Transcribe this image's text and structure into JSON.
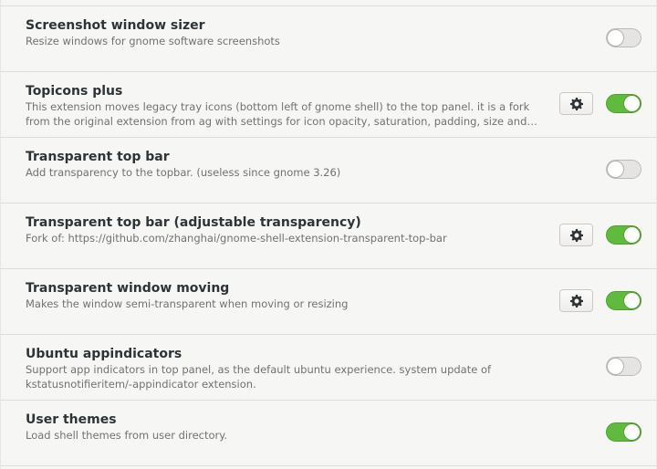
{
  "extensions": [
    {
      "title": "Screenshot window sizer",
      "description": "Resize windows for gnome software screenshots",
      "has_settings": false,
      "enabled": false
    },
    {
      "title": "Topicons plus",
      "description": "This extension moves legacy tray icons (bottom left of gnome shell) to the top panel. it is a fork from the original extension from ag  with settings for icon opacity, saturation, padding, size and tray posi…",
      "has_settings": true,
      "enabled": true
    },
    {
      "title": "Transparent top bar",
      "description": "Add transparency to the topbar. (useless since gnome 3.26)",
      "has_settings": false,
      "enabled": false
    },
    {
      "title": "Transparent top bar (adjustable transparency)",
      "description": "Fork of: https://github.com/zhanghai/gnome-shell-extension-transparent-top-bar",
      "has_settings": true,
      "enabled": true
    },
    {
      "title": "Transparent window moving",
      "description": "Makes the window semi-transparent when moving or resizing",
      "has_settings": true,
      "enabled": true
    },
    {
      "title": "Ubuntu appindicators",
      "description": "Support app indicators in top panel, as the default ubuntu experience. system update of kstatusnotifieritem/-appindicator extension.",
      "has_settings": false,
      "enabled": false
    },
    {
      "title": "User themes",
      "description": "Load shell themes from user directory.",
      "has_settings": false,
      "enabled": true
    }
  ],
  "icons": {
    "settings": "gear-icon"
  },
  "colors": {
    "toggle_on": "#5fbb3b",
    "toggle_off": "#e5e4e2"
  }
}
